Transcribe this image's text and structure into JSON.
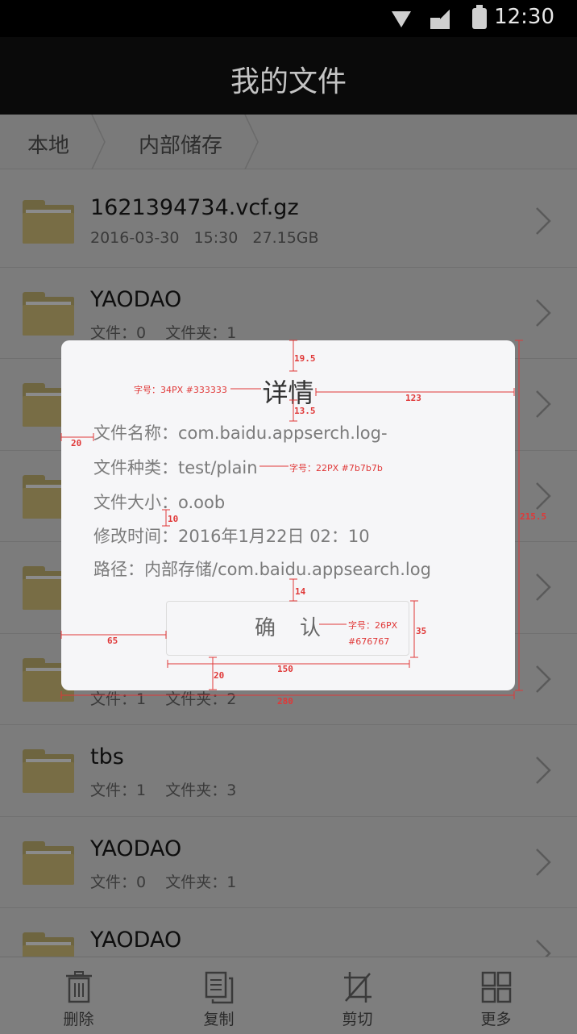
{
  "status_bar": {
    "time": "12:30",
    "icons": [
      "wifi-icon",
      "signal-icon",
      "battery-icon"
    ]
  },
  "header": {
    "title": "我的文件"
  },
  "breadcrumb": {
    "items": [
      "本地",
      "内部储存"
    ]
  },
  "files": [
    {
      "name": "1621394734.vcf.gz",
      "meta": "2016-03-30   15:30   27.15GB"
    },
    {
      "name": "YAODAO",
      "meta": "文件：0    文件夹：1"
    },
    {
      "name": "",
      "meta": ""
    },
    {
      "name": "",
      "meta": ""
    },
    {
      "name": "",
      "meta": ""
    },
    {
      "name": "",
      "meta": "文件：1    文件夹：2"
    },
    {
      "name": "tbs",
      "meta": "文件：1    文件夹：3"
    },
    {
      "name": "YAODAO",
      "meta": "文件：0    文件夹：1"
    },
    {
      "name": "YAODAO",
      "meta": ""
    }
  ],
  "dialog": {
    "title": "详情",
    "rows": [
      "文件名称：com.baidu.appserch.log-",
      "文件种类：test/plain",
      "文件大小：o.oob",
      "修改时间：2016年1月22日 02：10",
      "路径：内部存储/com.baidu.appsearch.log"
    ],
    "confirm_label": "确认"
  },
  "toolbar": {
    "items": [
      {
        "label": "删除",
        "icon": "trash-icon"
      },
      {
        "label": "复制",
        "icon": "copy-icon"
      },
      {
        "label": "剪切",
        "icon": "crop-icon"
      },
      {
        "label": "更多",
        "icon": "grid-icon"
      }
    ]
  },
  "annotations": {
    "title_spec": "字号：34PX #333333",
    "row_spec": "字号：22PX #7b7b7b",
    "button_spec_1": "字号：26PX",
    "button_spec_2": "#676767",
    "d_19_5": "19.5",
    "d_13_5": "13.5",
    "d_123": "123",
    "d_20": "20",
    "d_10": "10",
    "d_14": "14",
    "d_65": "65",
    "d_150": "150",
    "d_35": "35",
    "d_20b": "20",
    "d_280": "280",
    "d_215_5": "215.5",
    "color": "#e03838"
  }
}
